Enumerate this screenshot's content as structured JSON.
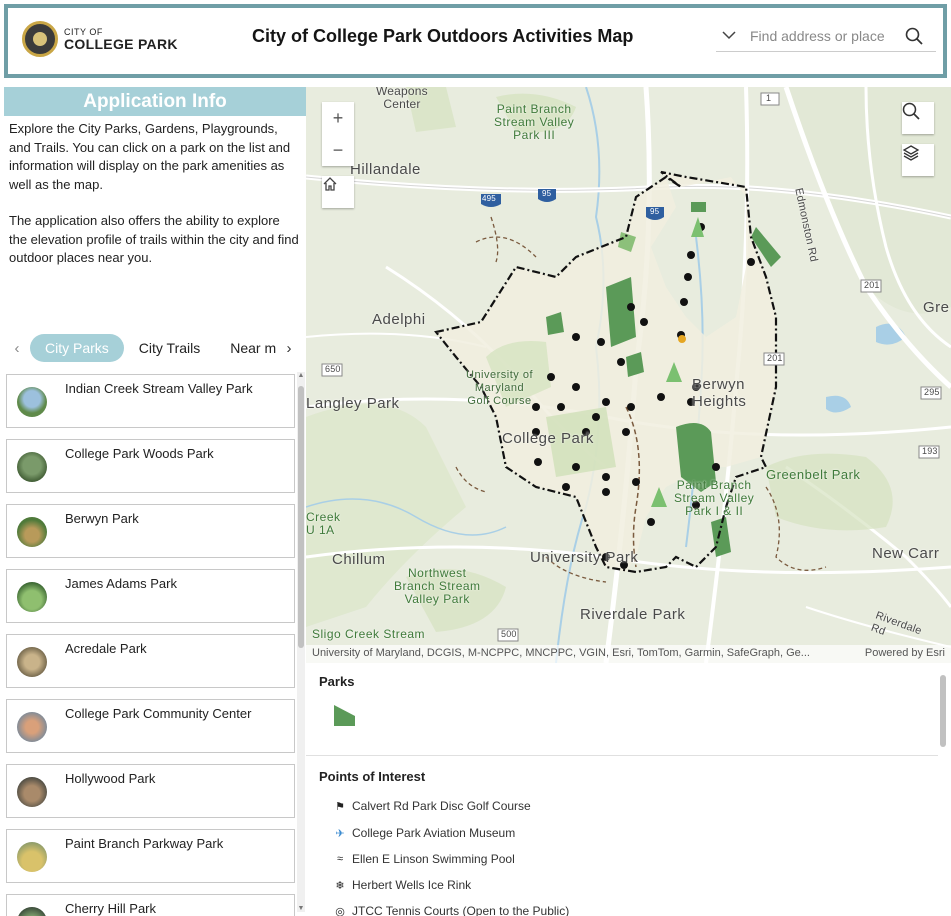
{
  "header": {
    "logo_small": "CITY OF",
    "logo_big": "COLLEGE PARK",
    "title": "City of College Park Outdoors Activities Map",
    "search_placeholder": "Find address or place"
  },
  "info": {
    "heading": "Application Info",
    "para1": "Explore the City Parks, Gardens, Playgrounds, and Trails. You can click on a park on the list and information will display on the park amenities as well as the map.",
    "para2": "The application also offers the ability to explore the elevation profile of trails within the city and find outdoor places near you."
  },
  "tabs": [
    {
      "label": "City Parks",
      "active": true
    },
    {
      "label": "City Trails",
      "active": false
    },
    {
      "label": "Near m",
      "active": false
    }
  ],
  "parks": [
    {
      "name": "Indian Creek Stream Valley Park"
    },
    {
      "name": "College Park Woods Park"
    },
    {
      "name": "Berwyn Park"
    },
    {
      "name": "James Adams Park"
    },
    {
      "name": "Acredale Park"
    },
    {
      "name": "College Park Community Center"
    },
    {
      "name": "Hollywood Park"
    },
    {
      "name": "Paint Branch Parkway Park"
    },
    {
      "name": "Cherry Hill Park"
    }
  ],
  "map": {
    "labels": {
      "weapons_center": "Weapons\nCenter",
      "paint_branch_iii": "Paint Branch\nStream Valley\nPark III",
      "hillandale": "Hillandale",
      "adelphi": "Adelphi",
      "umd": "University of\nMaryland\nGolf Course",
      "langley": "Langley Park",
      "college_park": "College Park",
      "berwyn": "Berwyn\nHeights",
      "greenbelt": "Greenbelt Park",
      "paint_branch_12": "Paint Branch\nStream Valley\nPark I & II",
      "chillum": "Chillum",
      "university_park": "University Park",
      "northwest": "Northwest\nBranch Stream\nValley Park",
      "riverdale": "Riverdale Park",
      "new_carr": "New Carr",
      "sligo": "Sligo Creek Stream",
      "creek": "Creek\nU 1A",
      "edmonston": "Edmonston Rd",
      "riverdale_rd": "Riverdale\nRd",
      "gre": "Gre",
      "route_1": "1",
      "route_495": "495",
      "route_95a": "95",
      "route_95b": "95",
      "route_201a": "201",
      "route_201b": "201",
      "route_650": "650",
      "route_295": "295",
      "route_500": "500",
      "route_193": "193"
    },
    "attribution": "University of Maryland, DCGIS, M-NCPPC, MNCPPC, VGIN, Esri, TomTom, Garmin, SafeGraph, Ge...",
    "powered_by": "Powered by Esri"
  },
  "legend": {
    "parks_title": "Parks",
    "poi_title": "Points of Interest",
    "poi_items": [
      {
        "label": "Calvert Rd Park Disc Golf Course",
        "icon": "disc-golf-icon",
        "glyph": "⚑"
      },
      {
        "label": "College Park Aviation Museum",
        "icon": "airplane-icon",
        "glyph": "✈"
      },
      {
        "label": "Ellen E Linson Swimming Pool",
        "icon": "swimmer-icon",
        "glyph": "≈"
      },
      {
        "label": "Herbert Wells Ice Rink",
        "icon": "skater-icon",
        "glyph": "❄"
      },
      {
        "label": "JTCC Tennis Courts (Open to the Public)",
        "icon": "tennis-icon",
        "glyph": "◎"
      }
    ]
  },
  "colors": {
    "accent": "#a6d0d8",
    "header_border": "#6f9ea6",
    "park_green": "#5b9a58",
    "map_bg": "#e8ecde"
  }
}
